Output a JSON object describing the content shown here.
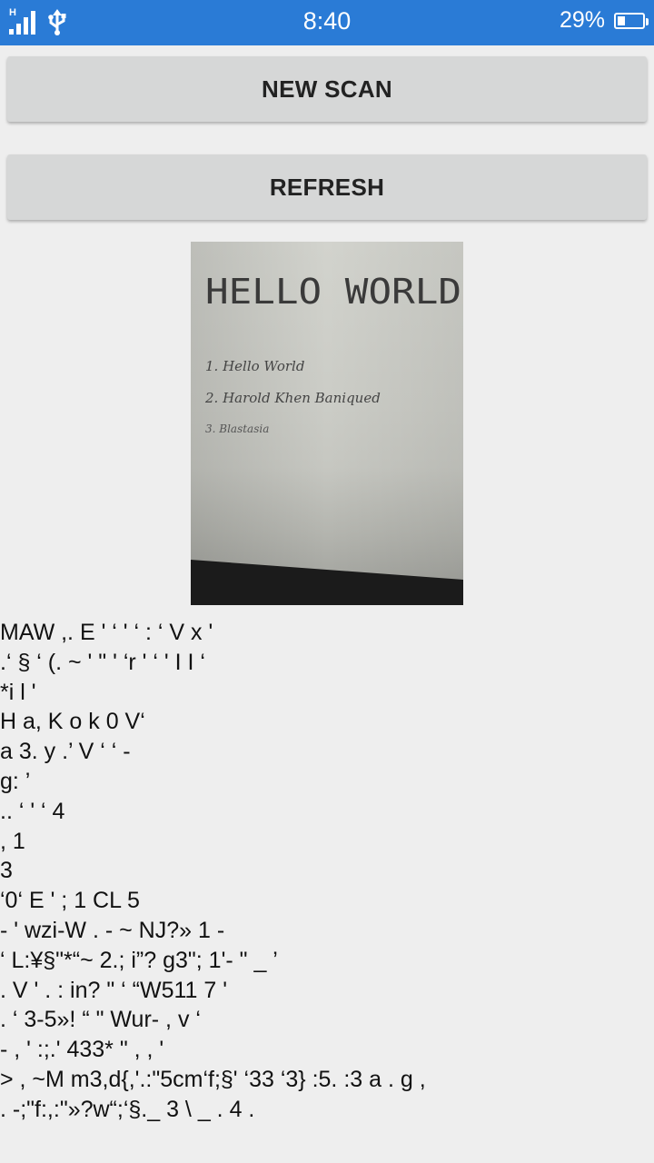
{
  "status_bar": {
    "network_type": "H",
    "time": "8:40",
    "battery_percent": "29%",
    "battery_level": 0.29,
    "icons": [
      "signal-icon",
      "usb-icon",
      "battery-icon"
    ]
  },
  "buttons": {
    "new_scan": "NEW SCAN",
    "refresh": "REFRESH"
  },
  "scanned_image": {
    "heading": "HELLO WORLD",
    "items": [
      "1. Hello World",
      "2. Harold Khen Baniqued",
      "3. Blastasia"
    ]
  },
  "ocr_result": {
    "lines": [
      "MAW ,. E ' ‘ ' ‘ : ‘ V x '",
      ".‘ § ‘ (. ~ ' \" ' ‘r ' ‘ ' I I ‘",
      "*i l '",
      "H a, K o k 0 V‘",
      "a 3. y .’ V ‘ ‘ -",
      "g: ’",
      ".. ‘ ' ‘ 4",
      ", 1",
      "3",
      "‘0‘ E ' ; 1 CL 5",
      "- ' wzi-W . - ~ NJ?» 1 -",
      "‘ L:¥§\"*“~ 2.; i”? g3\"; 1'- \" _ ’",
      ". V ' . : in? \" ‘ “W511 7 '",
      ". ‘ 3-5»! “ \" Wur- , v ‘",
      "- , ' :;.' 433* \" , , '",
      "> , ~M m3,d{,'.:\"5cm‘f;§' ‘33 ‘3} :5. :3 a . g ,",
      ". -;\"f:,:\"»?w“;‘§._ 3 \\ _ . 4 ."
    ]
  }
}
